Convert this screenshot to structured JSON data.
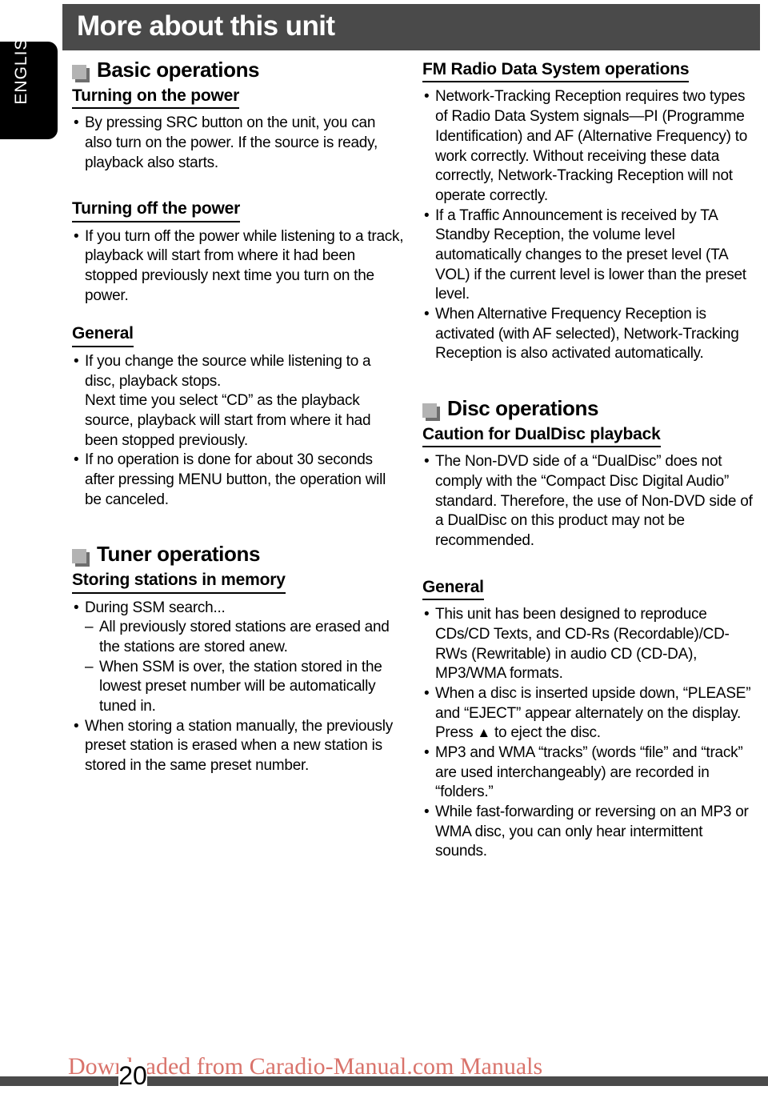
{
  "header": {
    "title": "More about this unit"
  },
  "language_tab": {
    "label": "ENGLISH"
  },
  "left_column": {
    "section1": {
      "marker": "square-marker-icon",
      "title": "Basic operations",
      "sub1": {
        "heading": "Turning on the power",
        "bullets": [
          "By pressing SRC button on the unit, you can also turn on the power. If the source is ready, playback also starts."
        ]
      },
      "sub2": {
        "heading": "Turning off the power",
        "bullets": [
          "If you turn off the power while listening to a track, playback will start from where it had been stopped previously next time you turn on the power."
        ]
      },
      "sub3": {
        "heading": "General",
        "bullets": [
          "If you change the source while listening to a disc, playback stops.\nNext time you select “CD” as the playback source, playback will start from where it had been stopped previously.",
          "If no operation is done for about 30 seconds after pressing MENU button, the operation will be canceled."
        ],
        "bullet1_line1": "If you change the source while listening to a disc, playback stops.",
        "bullet1_line2": "Next time you select “CD” as the playback source, playback will start from where it had been stopped previously.",
        "bullet2": "If no operation is done for about 30 seconds after pressing MENU button, the operation will be canceled."
      }
    },
    "section2": {
      "marker": "square-marker-icon",
      "title": "Tuner operations",
      "sub1": {
        "heading": "Storing stations in memory",
        "bullet1": "During SSM search...",
        "subbullet1": "All previously stored stations are erased and the stations are stored anew.",
        "subbullet2": "When SSM is over, the station stored in the lowest preset number will be automatically tuned in.",
        "bullet2": "When storing a station manually, the previously preset station is erased when a new station is stored in the same preset number."
      }
    }
  },
  "right_column": {
    "section1": {
      "heading": "FM Radio Data System operations",
      "bullet1": "Network-Tracking Reception requires two types of Radio Data System signals—PI (Programme Identification) and AF (Alternative Frequency) to work correctly. Without receiving these data correctly, Network-Tracking Reception will not operate correctly.",
      "bullet2": "If a Traffic Announcement is received by TA Standby Reception, the volume level automatically changes to the preset level (TA VOL) if the current level is lower than the preset level.",
      "bullet3": "When Alternative Frequency Reception is activated (with AF selected), Network-Tracking Reception is also activated automatically."
    },
    "section2": {
      "marker": "square-marker-icon",
      "title": "Disc operations",
      "sub1": {
        "heading": "Caution for DualDisc playback",
        "bullet1": "The Non-DVD side of a “DualDisc” does not comply with the “Compact Disc Digital Audio” standard. Therefore, the use of Non-DVD side of a DualDisc on this product may not be recommended."
      },
      "sub2": {
        "heading": "General",
        "bullet1": "This unit has been designed to reproduce CDs/CD Texts, and CD-Rs (Recordable)/CD-RWs (Rewritable) in audio CD (CD-DA), MP3/WMA formats.",
        "bullet2_part1": "When a disc is inserted upside down, “PLEASE” and “EJECT” appear alternately on the display. Press ",
        "bullet2_eject_icon": "▲",
        "bullet2_part2": " to eject the disc.",
        "bullet3": "MP3 and WMA “tracks” (words “file” and “track” are used interchangeably) are recorded in “folders.”",
        "bullet4": "While fast-forwarding or reversing on an MP3 or WMA disc, you can only hear intermittent sounds."
      }
    }
  },
  "footer": {
    "page_number": "20",
    "watermark": "Downloaded from Caradio-Manual.com Manuals"
  },
  "bullets": {
    "dot": "•",
    "dash": "–"
  },
  "colors": {
    "header_bar": "#4a4a4a",
    "tab_bg": "#000000",
    "marker_front": "#b3b3b3",
    "marker_back": "#6e6e6e",
    "watermark": "#d9736b"
  }
}
